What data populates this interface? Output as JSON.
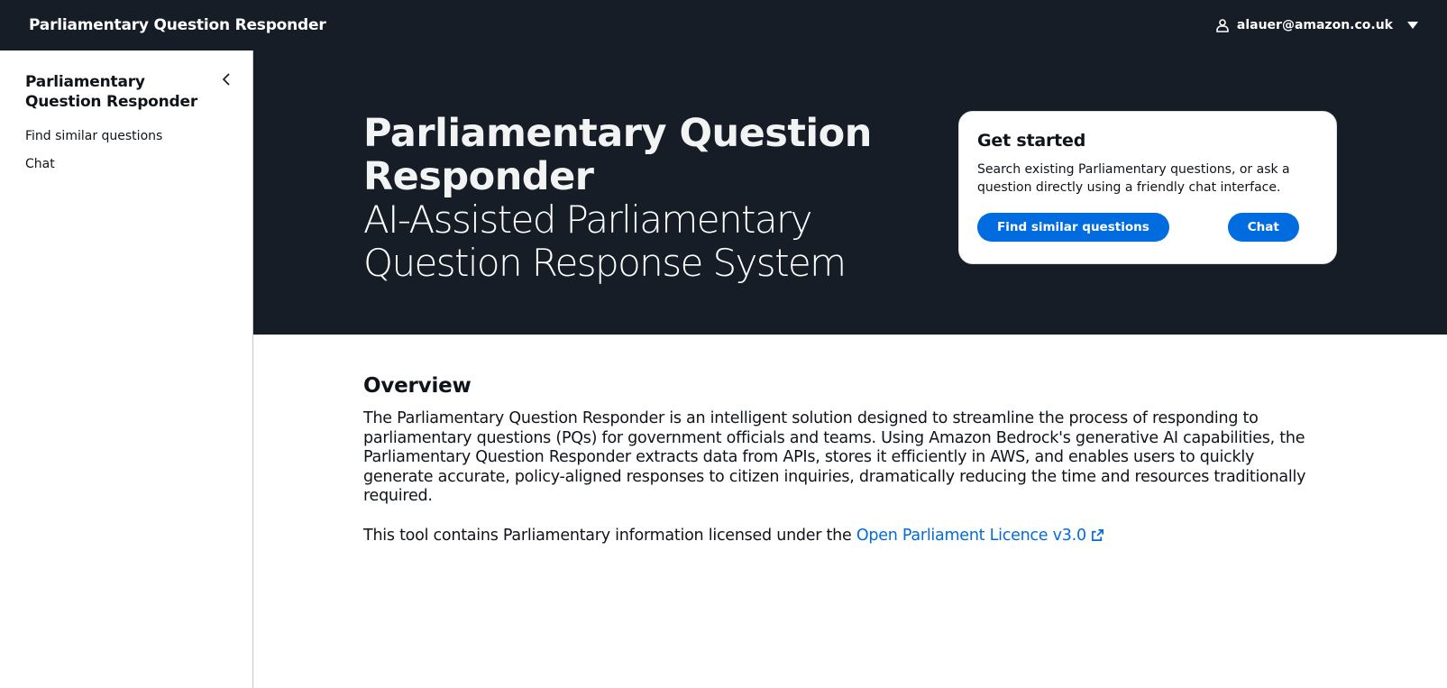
{
  "topbar": {
    "title": "Parliamentary Question Responder",
    "user_email": "alauer@amazon.co.uk"
  },
  "sidebar": {
    "title": "Parliamentary Question Responder",
    "items": [
      {
        "label": "Find similar questions"
      },
      {
        "label": "Chat"
      }
    ]
  },
  "hero": {
    "title": "Parliamentary Question Responder",
    "subtitle": "AI-Assisted Parliamentary Question Response System"
  },
  "get_started": {
    "title": "Get started",
    "description": "Search existing Parliamentary questions, or ask a question directly using a friendly chat interface.",
    "find_button": "Find similar questions",
    "chat_button": "Chat"
  },
  "overview": {
    "title": "Overview",
    "body": "The Parliamentary Question Responder is an intelligent solution designed to streamline the process of responding to parliamentary questions (PQs) for government officials and teams. Using Amazon Bedrock's generative AI capabilities, the Parliamentary Question Responder extracts data from APIs, stores it efficiently in AWS, and enables users to quickly generate accurate, policy-aligned responses to citizen inquiries, dramatically reducing the time and resources traditionally required.",
    "licence_prefix": "This tool contains Parliamentary information licensed under the ",
    "licence_link": "Open Parliament Licence v3.0"
  },
  "colors": {
    "topbar_bg": "#161d26",
    "accent": "#006ce0"
  },
  "icons": {
    "user": "user-icon",
    "caret": "caret-down-icon",
    "collapse": "chevron-left-icon",
    "external": "external-link-icon"
  }
}
